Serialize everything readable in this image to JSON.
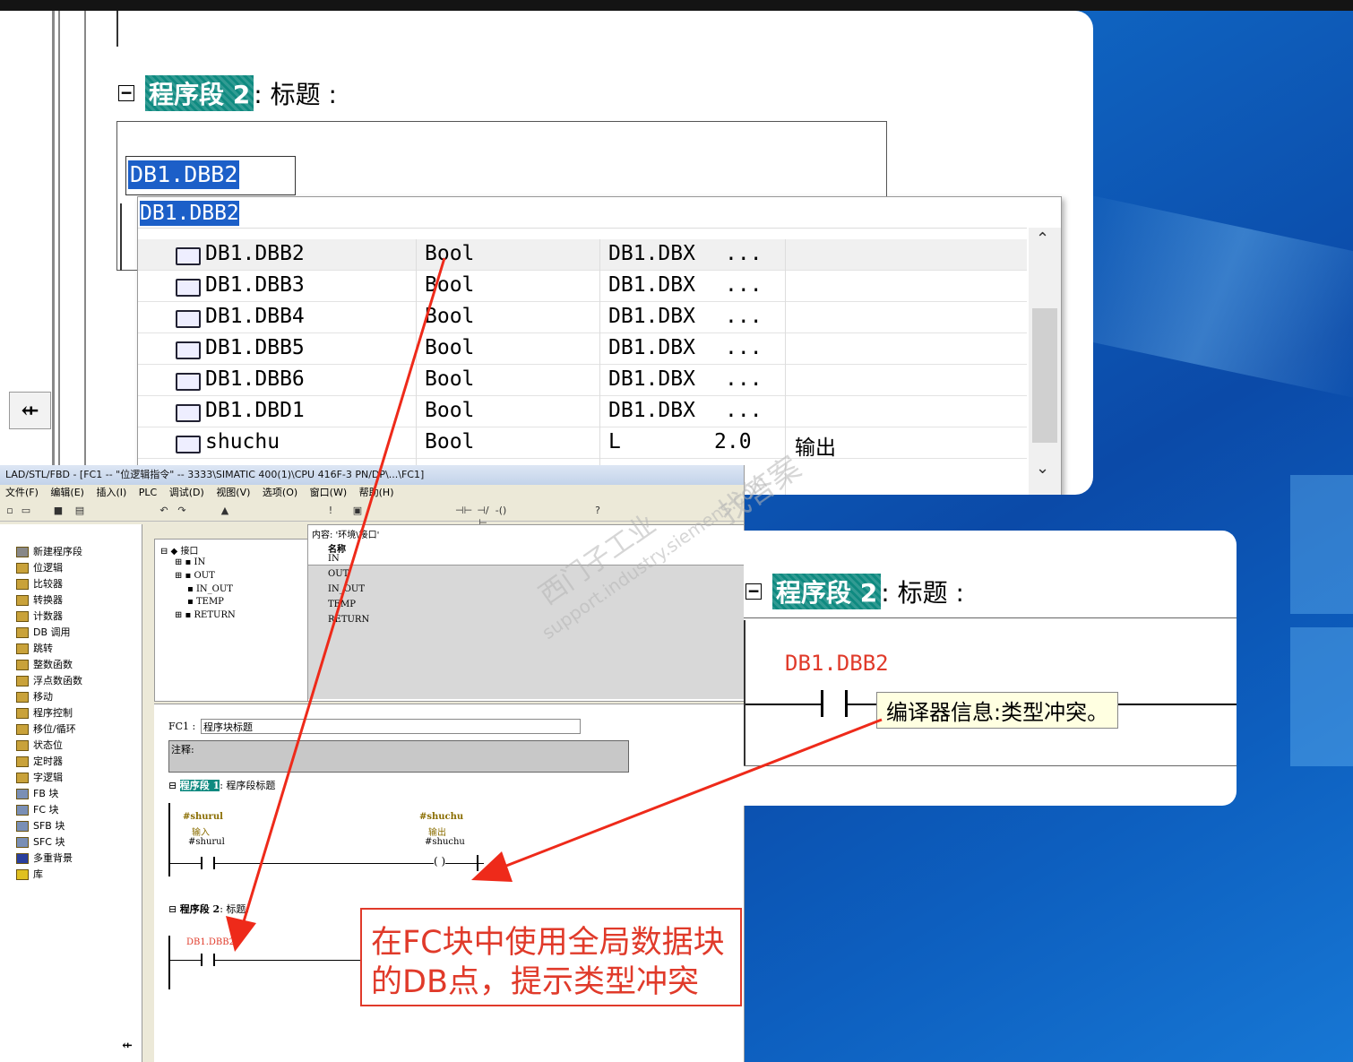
{
  "top_panel": {
    "segment_label": "程序段 2",
    "segment_title": ": 标题 :",
    "address_input": "DB1.DBB2",
    "dropdown_filter": "DB1.DBB2",
    "pointer_tool": "⇷",
    "rows": [
      {
        "name": "DB1.DBB2",
        "type": "Bool",
        "addr": "DB1.DBX",
        "extra": "...",
        "comment": ""
      },
      {
        "name": "DB1.DBB3",
        "type": "Bool",
        "addr": "DB1.DBX",
        "extra": "...",
        "comment": ""
      },
      {
        "name": "DB1.DBB4",
        "type": "Bool",
        "addr": "DB1.DBX",
        "extra": "...",
        "comment": ""
      },
      {
        "name": "DB1.DBB5",
        "type": "Bool",
        "addr": "DB1.DBX",
        "extra": "...",
        "comment": ""
      },
      {
        "name": "DB1.DBB6",
        "type": "Bool",
        "addr": "DB1.DBX",
        "extra": "...",
        "comment": ""
      },
      {
        "name": "DB1.DBD1",
        "type": "Bool",
        "addr": "DB1.DBX",
        "extra": "...",
        "comment": ""
      },
      {
        "name": "shuchu",
        "type": "Bool",
        "addr": "L",
        "extra": "2.0",
        "comment": "输出"
      }
    ]
  },
  "simatic": {
    "title": "LAD/STL/FBD - [FC1 -- \"位逻辑指令\" -- 3333\\SIMATIC 400(1)\\CPU 416F-3 PN/DP\\...\\FC1]",
    "menu": [
      "文件(F)",
      "编辑(E)",
      "插入(I)",
      "PLC",
      "调试(D)",
      "视图(V)",
      "选项(O)",
      "窗口(W)",
      "帮助(H)"
    ],
    "tree": [
      "新建程序段",
      "位逻辑",
      "比较器",
      "转换器",
      "计数器",
      "DB 调用",
      "跳转",
      "整数函数",
      "浮点数函数",
      "移动",
      "程序控制",
      "移位/循环",
      "状态位",
      "定时器",
      "字逻辑",
      "FB 块",
      "FC 块",
      "SFB 块",
      "SFC 块",
      "多重背景",
      "库"
    ],
    "iface_root": "接口",
    "iface_items": [
      "IN",
      "OUT",
      "IN_OUT",
      "TEMP",
      "RETURN"
    ],
    "content_label": "内容: '环境\\接口'",
    "col_name": "名称",
    "content_items": [
      "IN",
      "OUT",
      "IN_OUT",
      "TEMP",
      "RETURN"
    ],
    "fc_label": "FC1 :",
    "fc_title": "程序块标题",
    "comment_label": "注释:",
    "net1_label": "程序段 1",
    "net1_title": ": 程序段标题",
    "contact1_sym": "#shurul",
    "contact1_cmt": "输入",
    "contact1_name": "#shurul",
    "coil1_sym": "#shuchu",
    "coil1_cmt": "输出",
    "coil1_name": "#shuchu",
    "net2_label": "程序段 2",
    "net2_title": ": 标题:",
    "net2_contact": "DB1.DBB2"
  },
  "right_panel": {
    "segment_label": "程序段 2",
    "segment_title": ": 标题 :",
    "contact_addr": "DB1.DBB2",
    "tooltip": "编译器信息:类型冲突。"
  },
  "callout": {
    "line1": "在FC块中使用全局数据块",
    "line2": "的DB点，提示类型冲突"
  },
  "watermark": {
    "line1": "西门子工业",
    "line2": "support.industry.siemens.com",
    "line3": "找答案"
  },
  "colors": {
    "accent_red": "#e03a2a",
    "teal_tag": "#0e8a80",
    "selection": "#1c5fc8"
  }
}
